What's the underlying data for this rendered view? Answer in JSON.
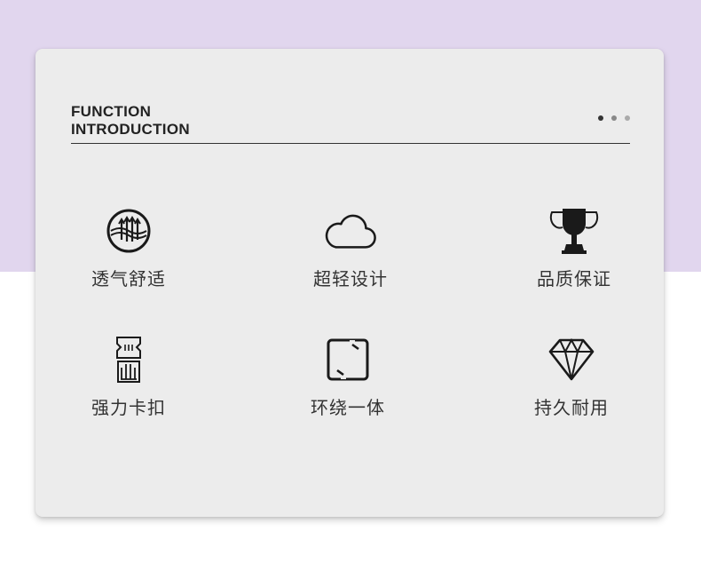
{
  "header": {
    "title_line1": "FUNCTION",
    "title_line2": "INTRODUCTION"
  },
  "pager": {
    "total": 3,
    "active": 1
  },
  "features": [
    {
      "label": "透气舒适",
      "icon": "breathable-icon"
    },
    {
      "label": "超轻设计",
      "icon": "cloud-icon"
    },
    {
      "label": "品质保证",
      "icon": "trophy-icon"
    },
    {
      "label": "强力卡扣",
      "icon": "buckle-icon"
    },
    {
      "label": "环绕一体",
      "icon": "wrap-around-icon"
    },
    {
      "label": "持久耐用",
      "icon": "diamond-icon"
    }
  ],
  "colors": {
    "background_band": "#e1d6ee",
    "card": "#ececec",
    "text": "#333333"
  }
}
